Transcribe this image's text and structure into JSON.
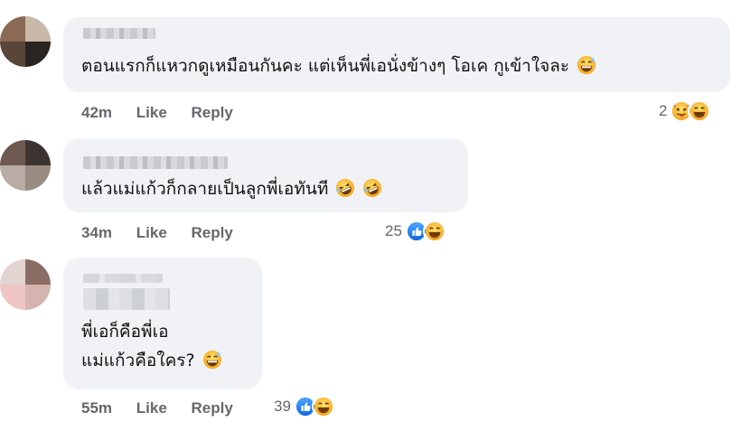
{
  "comments": [
    {
      "author_name": "",
      "text": "ตอนแรกก็แหวกดูเหมือนกันคะ แต่เห็นพี่เอนั่งข้างๆ โอเค กูเข้าใจละ",
      "trailing_emoji": "grinning-sweat-emoji",
      "time": "42m",
      "like_label": "Like",
      "reply_label": "Reply",
      "reaction_count": "2",
      "reaction_icons": [
        "tongue-out-emoji",
        "laughing-emoji"
      ]
    },
    {
      "author_name": "",
      "text": "แล้วแม่แก้วก็กลายเป็นลูกพี่เอทันที",
      "trailing_emoji": "rolling-laughing-emoji",
      "time": "34m",
      "like_label": "Like",
      "reply_label": "Reply",
      "reaction_count": "25",
      "reaction_icons": [
        "like-icon",
        "laughing-emoji"
      ]
    },
    {
      "author_name": "",
      "text_line1": "พี่เอก็คือพี่เอ",
      "text_line2": "แม่แก้วคือใคร?",
      "trailing_emoji": "grinning-sweat-emoji",
      "time": "55m",
      "like_label": "Like",
      "reply_label": "Reply",
      "reaction_count": "39",
      "reaction_icons": [
        "like-icon",
        "laughing-emoji"
      ]
    }
  ],
  "colors": {
    "bubble_bg": "#f0f2f5",
    "meta_text": "#65676b",
    "like_blue": "#1877f2",
    "emoji_yellow": "#f7b125"
  }
}
